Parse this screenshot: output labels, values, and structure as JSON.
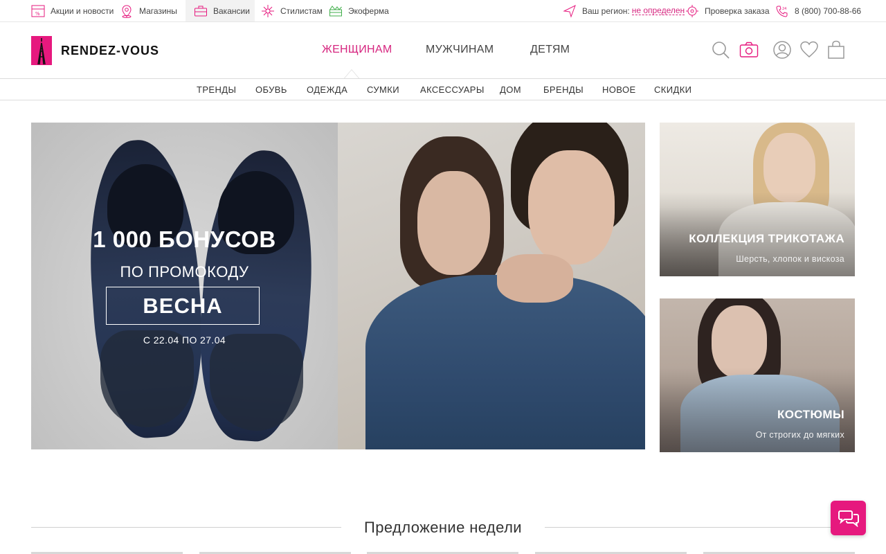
{
  "topbar": {
    "news_label": "Акции и новости",
    "stores_label": "Магазины",
    "vacancies_label": "Вакансии",
    "stylists_label": "Стилистам",
    "ecofarm_label": "Экоферма",
    "region_label": "Ваш регион:",
    "region_value": "не определен",
    "order_check_label": "Проверка заказа",
    "phone": "8 (800) 700-88-66"
  },
  "header": {
    "logo_text": "RENDEZ-VOUS",
    "main_nav": [
      {
        "label": "ЖЕНЩИНАМ",
        "active": true
      },
      {
        "label": "МУЖЧИНАМ",
        "active": false
      },
      {
        "label": "ДЕТЯМ",
        "active": false
      }
    ],
    "icons": [
      "search-icon",
      "camera-icon",
      "user-icon",
      "heart-icon",
      "bag-icon"
    ]
  },
  "subnav": {
    "items": [
      "ТРЕНДЫ",
      "ОБУВЬ",
      "ОДЕЖДА",
      "СУМКИ",
      "АКСЕССУАРЫ",
      "ДОМ",
      "БРЕНДЫ",
      "НОВОЕ",
      "СКИДКИ"
    ]
  },
  "hero": {
    "title": "1 000 БОНУСОВ",
    "subtitle": "ПО ПРОМОКОДУ",
    "promo_code": "ВЕСНА",
    "dates": "С 22.04 ПО 27.04"
  },
  "cards": [
    {
      "title": "КОЛЛЕКЦИЯ ТРИКОТАЖА",
      "subtitle": "Шерсть, хлопок и вискоза"
    },
    {
      "title": "КОСТЮМЫ",
      "subtitle": "От строгих до мягких"
    }
  ],
  "week_offer": {
    "title": "Предложение недели"
  },
  "colors": {
    "accent": "#e6197e",
    "link": "#d6257f"
  }
}
